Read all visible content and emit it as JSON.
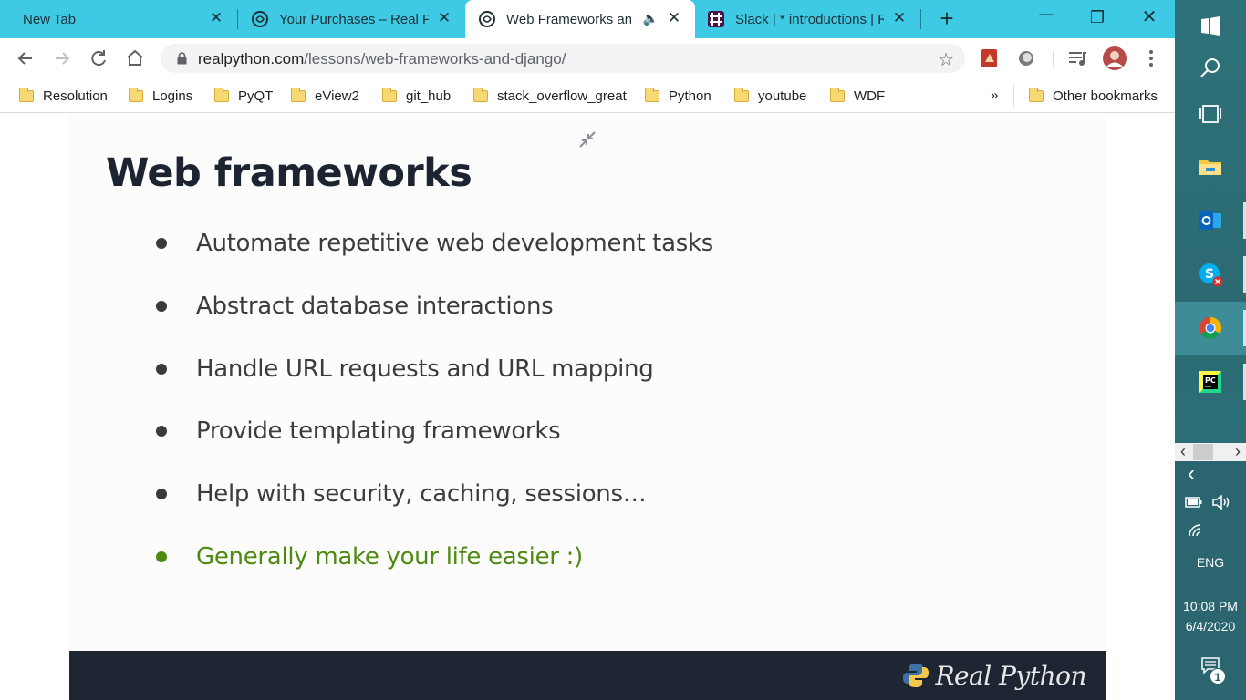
{
  "tabs": [
    {
      "title": "New Tab",
      "close": "✕"
    },
    {
      "title": "Your Purchases – Real Python",
      "close": "✕"
    },
    {
      "title": "Web Frameworks and Django",
      "close": "✕",
      "speaker": "🔈"
    },
    {
      "title": "Slack | * introductions | Real Python",
      "close": "✕"
    }
  ],
  "new_tab_label": "+",
  "window_controls": {
    "minimize": "—",
    "restore": "❐",
    "close": "✕"
  },
  "address_bar": {
    "domain": "realpython.com",
    "path": "/lessons/web-frameworks-and-django/",
    "star": "☆"
  },
  "bookmarks": [
    "Resolution",
    "Logins",
    "PyQT",
    "eView2",
    "git_hub",
    "stack_overflow_great",
    "Python",
    "youtube",
    "WDF"
  ],
  "bookmarks_overflow": "»",
  "other_bookmarks": "Other bookmarks",
  "slide": {
    "title": "Web frameworks",
    "bullets": [
      "Automate repetitive web development tasks",
      "Abstract database interactions",
      "Handle URL requests and URL mapping",
      "Provide templating frameworks",
      "Help with security, caching, sessions…"
    ],
    "highlight_bullet": "Generally make your life easier :)",
    "logo_text": "Real Python"
  },
  "taskbar": {
    "scroll_left": "‹",
    "scroll_right": "›",
    "tray_chevron": "‹",
    "language": "ENG",
    "time": "10:08 PM",
    "date": "6/4/2020",
    "notification_count": "1"
  },
  "colors": {
    "tabstrip": "#3ec9e4",
    "highlight": "#4f8a10",
    "slide_footer": "#1e2633",
    "taskbar": "#2c6b72"
  }
}
